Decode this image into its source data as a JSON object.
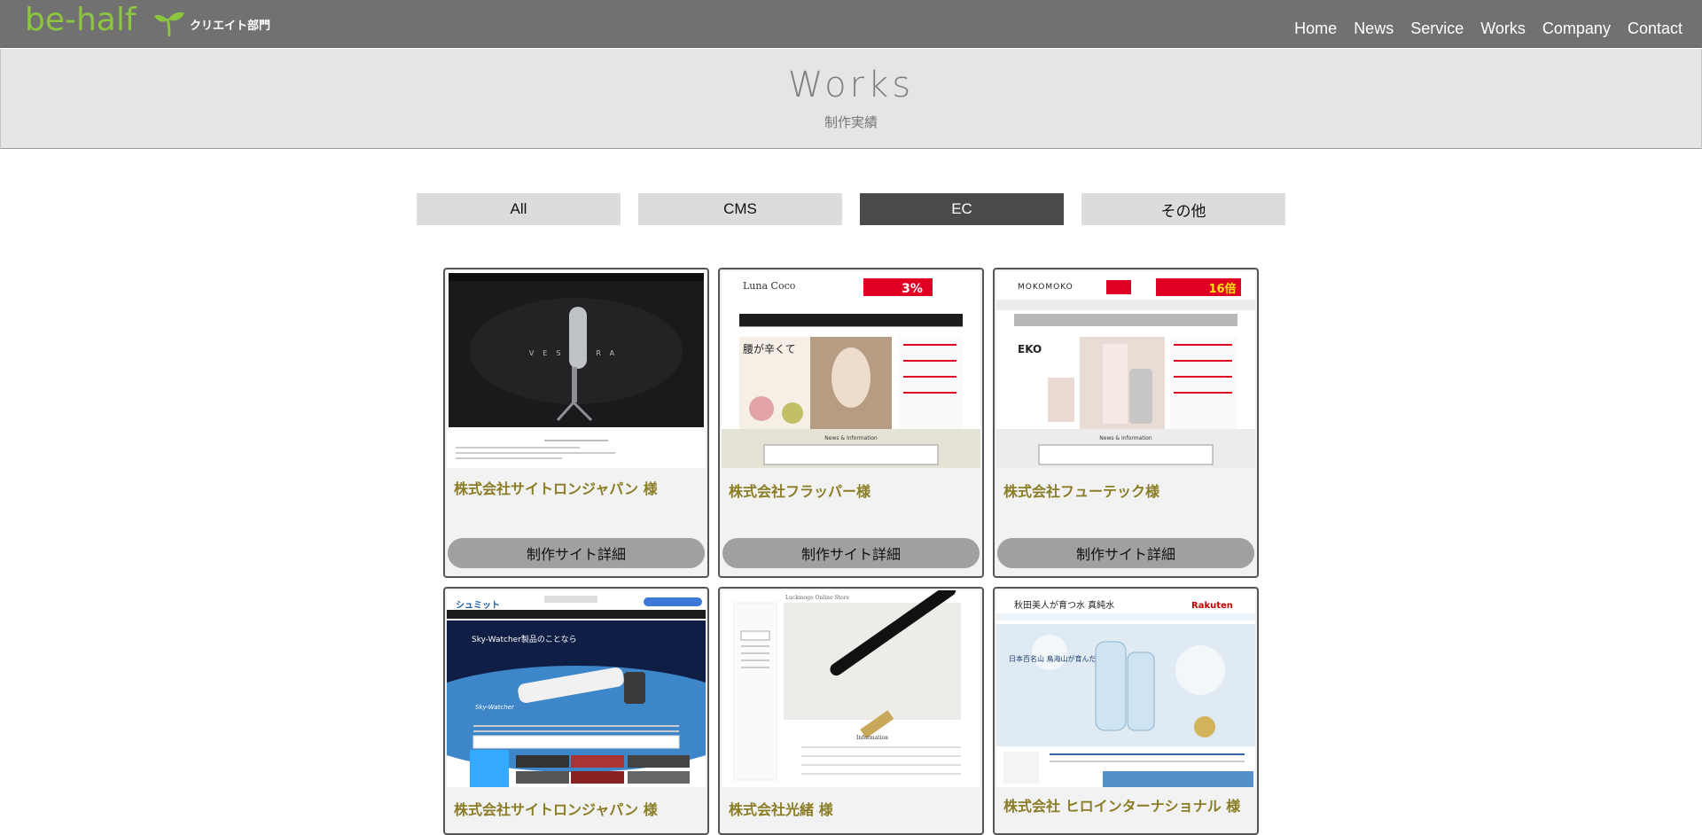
{
  "header": {
    "logo_text": "be-half",
    "logo_icon": "sprout-icon",
    "dept_label": "クリエイト部門",
    "nav": [
      "Home",
      "News",
      "Service",
      "Works",
      "Company",
      "Contact"
    ],
    "bg_color": "#717171",
    "brand_color": "#8cc63f"
  },
  "hero": {
    "title": "Works",
    "subtitle": "制作実績"
  },
  "filters": {
    "tabs": [
      "All",
      "CMS",
      "EC",
      "その他"
    ],
    "active": "EC"
  },
  "works": [
    {
      "title": "株式会社サイトロンジャパン 様",
      "button": "制作サイト詳細",
      "thumb": {
        "brand": "VESPERA"
      }
    },
    {
      "title": "株式会社フラッパー様",
      "button": "制作サイト詳細",
      "thumb": {
        "brand": "Luna Coco",
        "badge": "3%",
        "headline": "腰が辛くて",
        "section": "News & Information"
      }
    },
    {
      "title": "株式会社フューテック様",
      "button": "制作サイト詳細",
      "thumb": {
        "brand": "MOKOMOKO",
        "badge": "16倍",
        "headline": "EKO",
        "section": "News & Information"
      }
    },
    {
      "title": "株式会社サイトロンジャパン 様",
      "thumb": {
        "brand": "シュミット",
        "headline": "Sky-Watcher製品のことなら",
        "sub": "Sky-Watcher"
      }
    },
    {
      "title": "株式会社光緒 様",
      "thumb": {
        "brand": "Luckmogo Online Store",
        "section": "Information"
      }
    },
    {
      "title": "株式会社 ヒロインターナショナル 様",
      "thumb": {
        "brand": "秋田美人が育つ水 真純水",
        "headline": "日本百名山 鳥海山が育んだ名水！",
        "logo": "Rakuten"
      }
    }
  ]
}
